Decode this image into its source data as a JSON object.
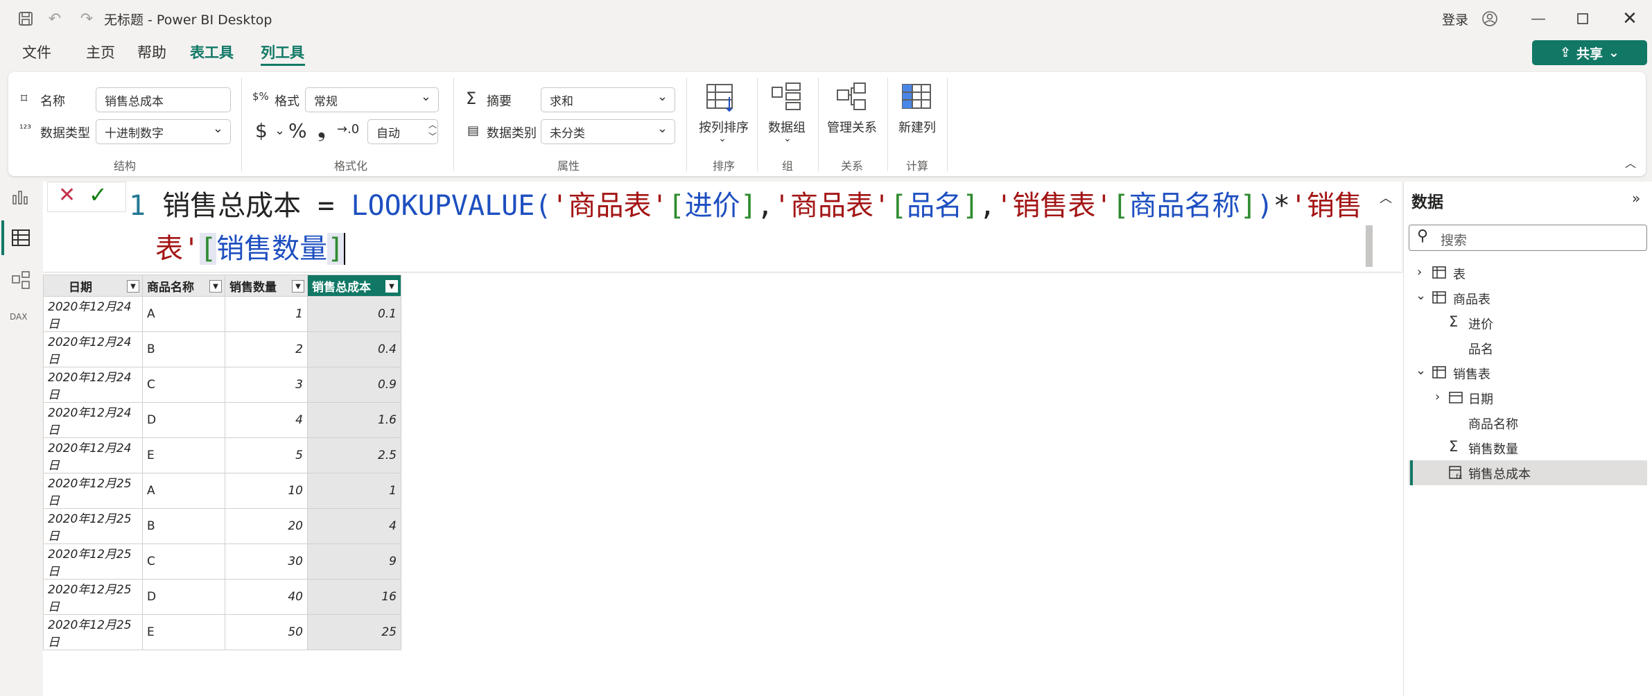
{
  "window": {
    "title": "无标题 - Power BI Desktop",
    "login": "登录"
  },
  "menu": {
    "file": "文件",
    "home": "主页",
    "help": "帮助",
    "table_tools": "表工具",
    "column_tools": "列工具",
    "share": "共享"
  },
  "ribbon": {
    "name_label": "名称",
    "name_value": "销售总成本",
    "datatype_label": "数据类型",
    "datatype_value": "十进制数字",
    "structure_group": "结构",
    "format_label": "格式",
    "format_value": "常规",
    "currency": "$",
    "percent": "%",
    "comma": "❟",
    "decimal_value": "自动",
    "formatting_group": "格式化",
    "summary_label": "摘要",
    "summary_value": "求和",
    "category_label": "数据类别",
    "category_value": "未分类",
    "properties_group": "属性",
    "sort_by_column": "按列排序",
    "sort_group": "排序",
    "data_groups": "数据组",
    "groups_group": "组",
    "manage_relationships": "管理关系",
    "relationships_group": "关系",
    "new_column": "新建列",
    "calc_group": "计算"
  },
  "formula": {
    "line_no": "1",
    "line1_name": "销售总成本",
    "line1_eq": " = ",
    "func": "LOOKUPVALUE(",
    "p1": "'商品表'",
    "b1o": "[",
    "c1": "进价",
    "b1c": "]",
    "com1": ",",
    "p2": "'商品表'",
    "b2o": "[",
    "c2": "品名",
    "b2c": "]",
    "com2": ",",
    "p3": "'销售表'",
    "b3o": "[",
    "c3": "商品名称",
    "b3c": "]",
    "close": ")",
    "mul": "*",
    "p4a": "'销售",
    "p4b": "表'",
    "b4o": "[",
    "c4": "销售数量",
    "b4c": "]"
  },
  "table": {
    "headers": [
      "日期",
      "商品名称",
      "销售数量",
      "销售总成本"
    ],
    "rows": [
      [
        "2020年12月24日",
        "A",
        "1",
        "0.1"
      ],
      [
        "2020年12月24日",
        "B",
        "2",
        "0.4"
      ],
      [
        "2020年12月24日",
        "C",
        "3",
        "0.9"
      ],
      [
        "2020年12月24日",
        "D",
        "4",
        "1.6"
      ],
      [
        "2020年12月24日",
        "E",
        "5",
        "2.5"
      ],
      [
        "2020年12月25日",
        "A",
        "10",
        "1"
      ],
      [
        "2020年12月25日",
        "B",
        "20",
        "4"
      ],
      [
        "2020年12月25日",
        "C",
        "30",
        "9"
      ],
      [
        "2020年12月25日",
        "D",
        "40",
        "16"
      ],
      [
        "2020年12月25日",
        "E",
        "50",
        "25"
      ]
    ]
  },
  "data_pane": {
    "title": "数据",
    "search_placeholder": "搜索",
    "items": [
      "表",
      "商品表",
      "进价",
      "品名",
      "销售表",
      "日期",
      "商品名称",
      "销售数量",
      "销售总成本"
    ]
  },
  "colors": {
    "accent": "#117865",
    "keyword": "#1e4fc0",
    "bracket": "#2e8b2e",
    "string": "#a31515"
  }
}
